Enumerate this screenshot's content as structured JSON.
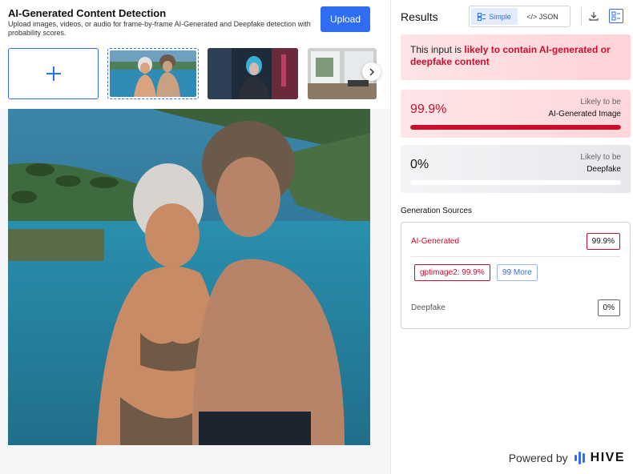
{
  "header": {
    "title": "AI-Generated Content Detection",
    "subtitle": "Upload images, videos, or audio for frame-by-frame AI-Generated and Deepfake detection with probability scores.",
    "upload_label": "Upload"
  },
  "thumbnails": [
    {
      "name": "couple-at-infinity-pool",
      "selected": true
    },
    {
      "name": "neon-cyberpunk-woman",
      "selected": false
    },
    {
      "name": "modern-interior-room",
      "selected": false
    }
  ],
  "results": {
    "title": "Results",
    "view_simple": "Simple",
    "view_json": "</> JSON",
    "verdict_prefix": "This input is ",
    "verdict_emphasis": "likely to contain AI-generated or deepfake content",
    "ai_generated": {
      "score_text": "99.9%",
      "score": 0.999,
      "label_line1": "Likely to be",
      "label_line2": "AI-Generated Image"
    },
    "deepfake": {
      "score_text": "0%",
      "score": 0.0,
      "label_line1": "Likely to be",
      "label_line2": "Deepfake"
    }
  },
  "generation_sources": {
    "title": "Generation Sources",
    "ai_label": "AI-Generated",
    "ai_score": "99.9%",
    "top_model": "gptimage2: 99.9%",
    "more_label": "99 More",
    "deepfake_label": "Deepfake",
    "deepfake_score": "0%"
  },
  "footer": {
    "powered_by": "Powered by",
    "brand": "HIVE"
  },
  "colors": {
    "accent": "#2f6ef3",
    "danger": "#c8102e"
  }
}
